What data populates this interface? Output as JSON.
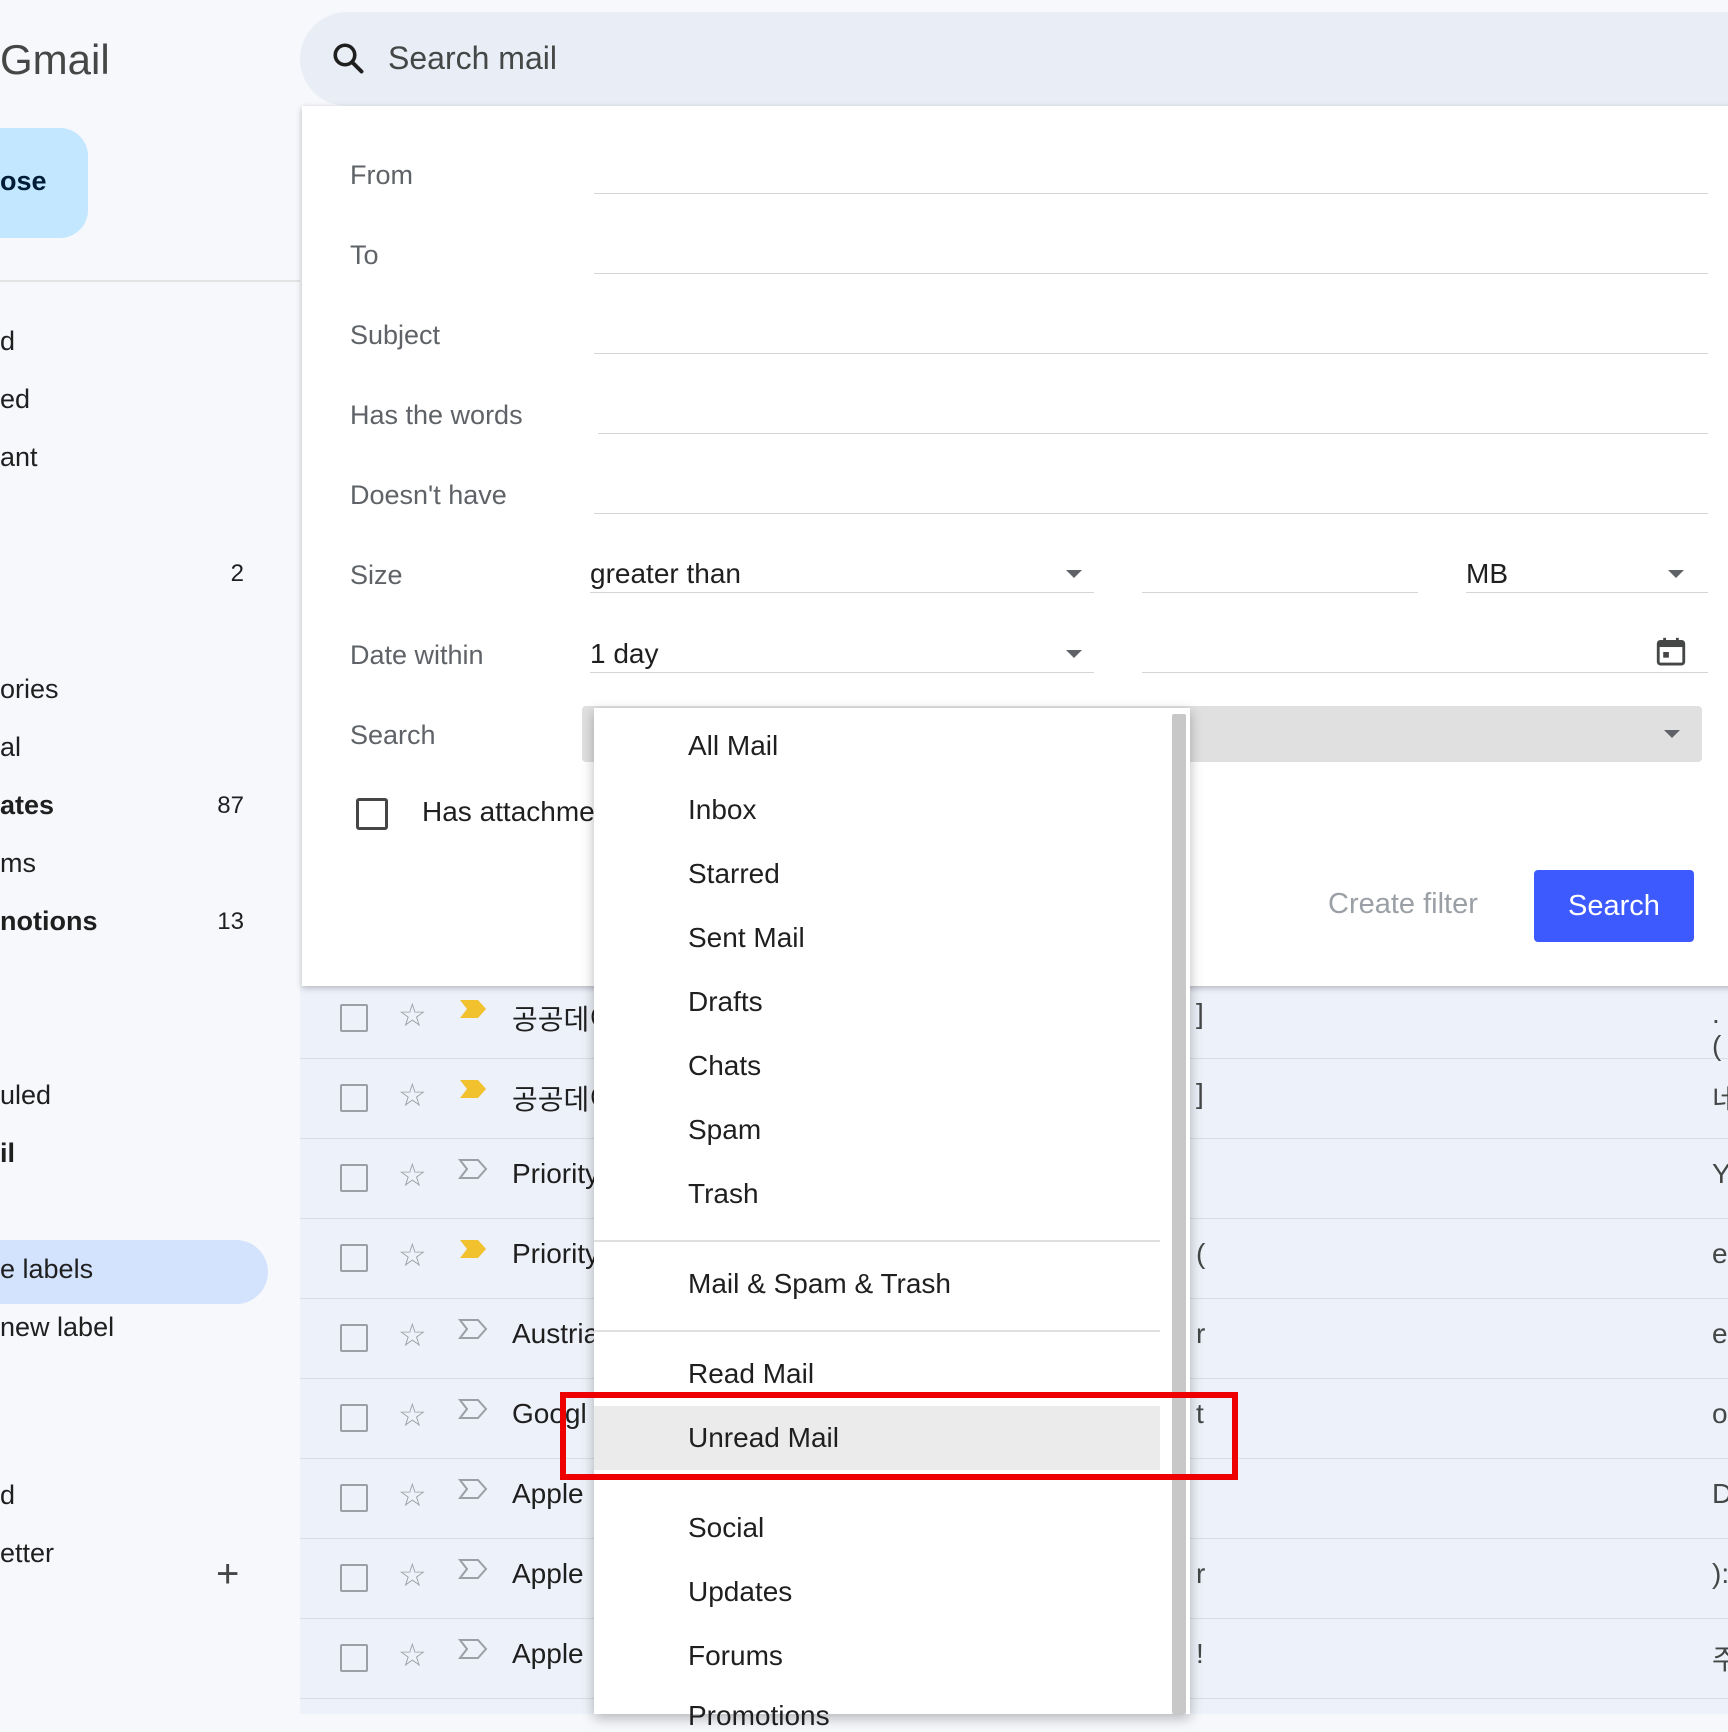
{
  "app": {
    "logo_text": "Gmail"
  },
  "sidebar": {
    "compose_label": "ose",
    "items": [
      {
        "label": "d"
      },
      {
        "label": "ed"
      },
      {
        "label": "ant"
      },
      {
        "count": "2"
      },
      {
        "label": "ories"
      },
      {
        "label": "al"
      },
      {
        "label": "ates",
        "count": "87"
      },
      {
        "label": "ms"
      },
      {
        "label": "notions",
        "count": "13"
      },
      {
        "label": "uled"
      },
      {
        "label": "il"
      },
      {
        "label": "e labels"
      },
      {
        "label": " new label"
      },
      {
        "label": "d"
      },
      {
        "label": "etter"
      }
    ],
    "add_label_icon": "+"
  },
  "search": {
    "placeholder": "Search mail"
  },
  "advanced": {
    "from_label": "From",
    "to_label": "To",
    "subject_label": "Subject",
    "has_words_label": "Has the words",
    "doesnt_have_label": "Doesn't have",
    "size_label": "Size",
    "size_operator": "greater than",
    "size_unit": "MB",
    "date_within_label": "Date within",
    "date_within_value": "1 day",
    "search_in_label": "Search",
    "has_attachment_label": "Has attachme",
    "create_filter_label": "Create filter",
    "search_button_label": "Search"
  },
  "email_rows": [
    {
      "sender": "공공데이",
      "important": true,
      "frag1": "]",
      "frag2": ".("
    },
    {
      "sender": "공공데이",
      "important": true,
      "frag1": "]",
      "frag2": "네"
    },
    {
      "sender": "Priority",
      "important": false,
      "frag1": "",
      "frag2": "Y"
    },
    {
      "sender": "Priority",
      "important": true,
      "frag1": "(",
      "frag2": "el"
    },
    {
      "sender": "Austria",
      "important": false,
      "frag1": "r",
      "frag2": "e"
    },
    {
      "sender": "Googl",
      "important": false,
      "frag1": "t",
      "frag2": "ol"
    },
    {
      "sender": "Apple",
      "important": false,
      "frag1": "",
      "frag2": "D"
    },
    {
      "sender": "Apple",
      "important": false,
      "frag1": "r",
      "frag2": "):"
    },
    {
      "sender": "Apple",
      "important": false,
      "frag1": "!",
      "frag2": "주"
    }
  ],
  "dropdown": {
    "group1": [
      "All Mail",
      "Inbox",
      "Starred",
      "Sent Mail",
      "Drafts",
      "Chats",
      "Spam",
      "Trash"
    ],
    "group2": [
      "Mail & Spam & Trash"
    ],
    "group3": [
      "Read Mail",
      "Unread Mail"
    ],
    "group4": [
      "Social",
      "Updates",
      "Forums",
      "Promotions"
    ],
    "highlighted": "Unread Mail"
  },
  "annotation": {
    "highlight_color": "#ee0000"
  }
}
